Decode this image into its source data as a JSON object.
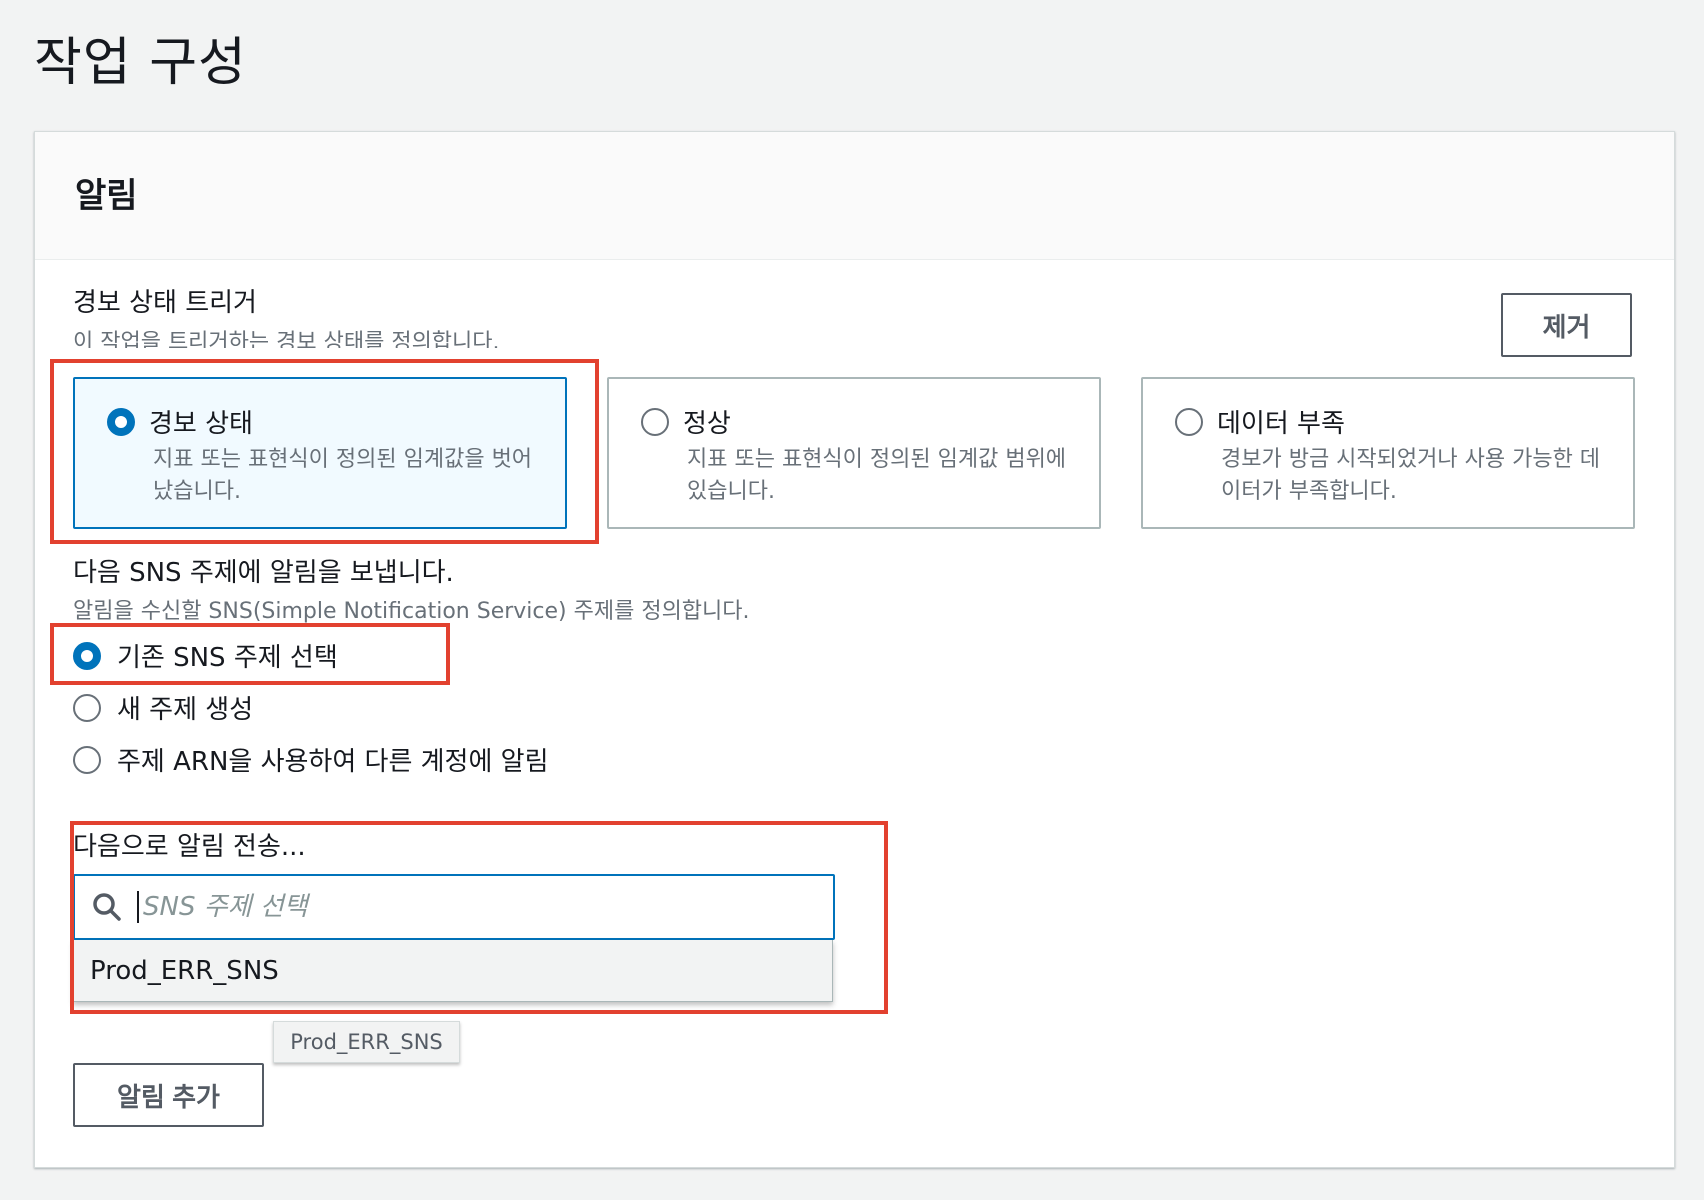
{
  "page": {
    "title": "작업 구성"
  },
  "panel": {
    "title": "알림",
    "remove_label": "제거",
    "trigger": {
      "label": "경보 상태 트리거",
      "description": "이 작업을 트리거하는 경보 상태를 정의합니다.",
      "options": [
        {
          "title": "경보 상태",
          "description": "지표 또는 표현식이 정의된 임계값을 벗어났습니다.",
          "selected": true
        },
        {
          "title": "정상",
          "description": "지표 또는 표현식이 정의된 임계값 범위에 있습니다.",
          "selected": false
        },
        {
          "title": "데이터 부족",
          "description": "경보가 방금 시작되었거나 사용 가능한 데이터가 부족합니다.",
          "selected": false
        }
      ]
    },
    "sns": {
      "label": "다음 SNS 주제에 알림을 보냅니다.",
      "description": "알림을 수신할 SNS(Simple Notification Service) 주제를 정의합니다.",
      "options": [
        {
          "label": "기존 SNS 주제 선택",
          "selected": true
        },
        {
          "label": "새 주제 생성",
          "selected": false
        },
        {
          "label": "주제 ARN을 사용하여 다른 계정에 알림",
          "selected": false
        }
      ]
    },
    "send_to": {
      "label": "다음으로 알림 전송...",
      "placeholder": "SNS 주제 선택",
      "value": "",
      "dropdown_items": [
        "Prod_ERR_SNS"
      ],
      "tooltip": "Prod_ERR_SNS"
    },
    "add_notification_label": "알림 추가"
  },
  "colors": {
    "accent": "#0073bb",
    "highlight": "#e2412f",
    "text": "#16191f",
    "muted": "#687078"
  }
}
